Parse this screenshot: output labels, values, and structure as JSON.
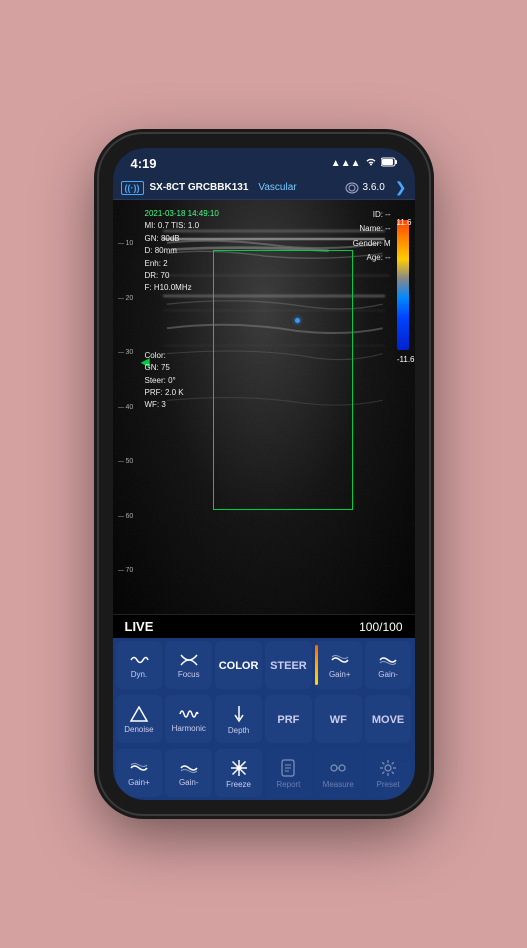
{
  "status_bar": {
    "time": "4:19",
    "signal": "▲▲▲",
    "wifi": "wifi",
    "battery": "🔋"
  },
  "header": {
    "logo": "((·))",
    "device": "SX-8CT GRCBBK131",
    "mode": "Vascular",
    "version_icon": "🔊",
    "version": "3.6.0",
    "back": "❯"
  },
  "overlay": {
    "date_time": "2021-03-18 14:49:10",
    "mi": "MI: 0.7",
    "tis": "TIS: 1.0",
    "gn": "GN: 80dB",
    "d": "D: 80mm",
    "enh": "Enh: 2",
    "dr": "DR: 70",
    "f": "F: H10.0MHz",
    "color": "Color:",
    "color_gn": "GN: 75",
    "steer": "Steer: 0°",
    "prf": "PRF: 2.0 K",
    "wf": "WF: 3",
    "id": "ID: --",
    "name": "Name: --",
    "gender": "Gender: M",
    "age": "Age: --"
  },
  "color_bar": {
    "top": "11.6",
    "bottom": "-11.6"
  },
  "scale": {
    "ticks": [
      "10",
      "20",
      "30",
      "40",
      "50",
      "60",
      "70"
    ]
  },
  "status_bottom": {
    "live": "LIVE",
    "frames": "100/100"
  },
  "buttons": {
    "row1": [
      {
        "id": "dyn",
        "icon": "〜",
        "label": "Dyn.",
        "active": false
      },
      {
        "id": "focus",
        "icon": "):(",
        "label": "Focus",
        "active": false
      },
      {
        "id": "color",
        "icon": "",
        "label": "COLOR",
        "active": false,
        "highlighted": false
      },
      {
        "id": "steer",
        "icon": "",
        "label": "STEER",
        "active": false
      },
      {
        "id": "gain_plus",
        "icon": "≋",
        "label": "Gain+",
        "active": false
      },
      {
        "id": "gain_minus",
        "icon": "≋",
        "label": "Gain-",
        "active": false
      }
    ],
    "row2": [
      {
        "id": "denoise",
        "icon": "△",
        "label": "Denoise",
        "active": false
      },
      {
        "id": "harmonic",
        "icon": "∿",
        "label": "Harmonic",
        "active": false
      },
      {
        "id": "depth",
        "icon": "♦",
        "label": "Depth",
        "active": false
      },
      {
        "id": "prf",
        "icon": "",
        "label": "PRF",
        "active": false
      },
      {
        "id": "wf",
        "icon": "",
        "label": "WF",
        "active": false
      },
      {
        "id": "move",
        "icon": "",
        "label": "MOVE",
        "active": false
      }
    ],
    "row3": [
      {
        "id": "gain_plus2",
        "icon": "≋",
        "label": "Gain+",
        "active": false
      },
      {
        "id": "gain_minus2",
        "icon": "≋",
        "label": "Gain-",
        "active": false
      },
      {
        "id": "freeze",
        "icon": "❄",
        "label": "Freeze",
        "active": false
      },
      {
        "id": "report",
        "icon": "📋",
        "label": "Report",
        "active": false,
        "disabled": true
      },
      {
        "id": "measure",
        "icon": "📏",
        "label": "Measure",
        "active": false,
        "disabled": true
      },
      {
        "id": "preset",
        "icon": "⚙",
        "label": "Preset",
        "active": false,
        "disabled": true
      }
    ]
  }
}
